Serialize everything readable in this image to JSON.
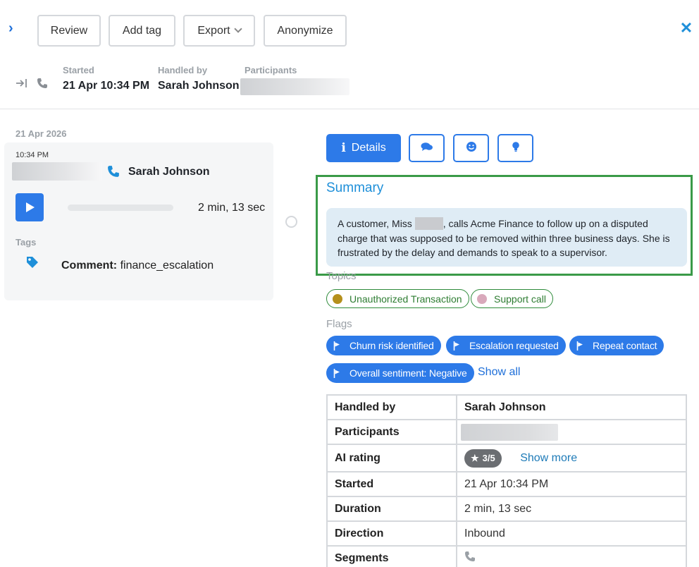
{
  "toolbar": {
    "review": "Review",
    "add_tag": "Add tag",
    "export": "Export",
    "anonymize": "Anonymize"
  },
  "meta": {
    "started_label": "Started",
    "started_value": "21 Apr 10:34 PM",
    "handled_by_label": "Handled by",
    "handled_by_value": "Sarah Johnson",
    "participants_label": "Participants"
  },
  "timeline": {
    "date": "21 Apr 2026",
    "card": {
      "time": "10:34 PM",
      "agent": "Sarah Johnson",
      "duration": "2 min, 13 sec",
      "playback_progress": 0,
      "tags_label": "Tags",
      "tag_prefix": "Comment:",
      "tag_value": "finance_escalation"
    }
  },
  "tabs": {
    "details": "Details",
    "icons": [
      "chat-bubbles-icon",
      "smile-icon",
      "lightbulb-icon"
    ]
  },
  "summary": {
    "title": "Summary",
    "text_before": "A customer, Miss",
    "text_after": ", calls Acme Finance to follow up on a disputed charge that was supposed to be removed within three business days. She is frustrated by the delay and demands to speak to a supervisor."
  },
  "topics": {
    "label": "Topics",
    "items": [
      {
        "label": "Unauthorized Transaction",
        "color": "#b5901c"
      },
      {
        "label": "Support call",
        "color": "#d9a9bb"
      }
    ]
  },
  "flags": {
    "label": "Flags",
    "items": [
      "Churn risk identified",
      "Escalation requested",
      "Repeat contact",
      "Overall sentiment: Negative"
    ],
    "show_all": "Show all"
  },
  "details_table": {
    "handled_by_label": "Handled by",
    "handled_by_value": "Sarah Johnson",
    "participants_label": "Participants",
    "ai_rating_label": "AI rating",
    "ai_rating_value": "3/5",
    "show_more": "Show more",
    "started_label": "Started",
    "started_value": "21 Apr 10:34 PM",
    "duration_label": "Duration",
    "duration_value": "2 min, 13 sec",
    "direction_label": "Direction",
    "direction_value": "Inbound",
    "segments_label": "Segments"
  },
  "colors": {
    "accent_blue": "#2d7ae8",
    "link_blue": "#1e8fd9",
    "highlight_green": "#3a9a48",
    "summary_bg": "#dfecf5"
  }
}
